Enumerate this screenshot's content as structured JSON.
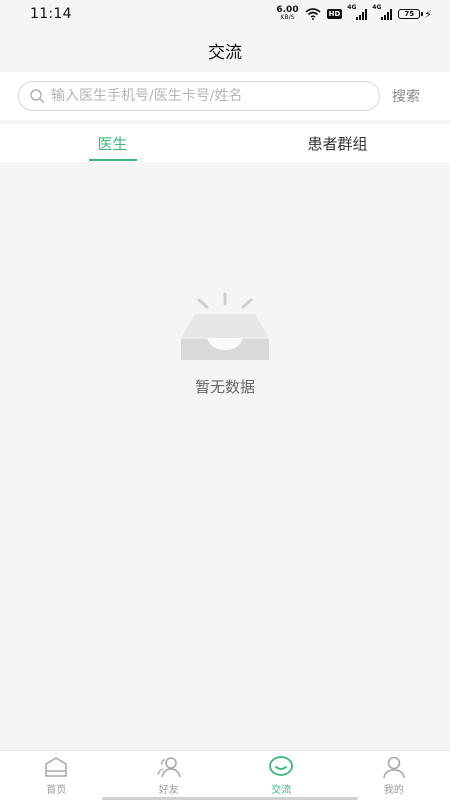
{
  "status_bar": {
    "time": "11:14",
    "net_speed": "6.00",
    "net_unit": "KB/S",
    "hd_badge": "HD",
    "signal_1": "4G",
    "signal_2": "4G",
    "battery": "75"
  },
  "header": {
    "title": "交流"
  },
  "search": {
    "placeholder": "输入医生手机号/医生卡号/姓名",
    "value": "",
    "button_label": "搜索"
  },
  "tabs": [
    {
      "label": "医生",
      "active": true
    },
    {
      "label": "患者群组",
      "active": false
    }
  ],
  "empty_state": {
    "message": "暂无数据"
  },
  "bottom_nav": {
    "items": [
      {
        "label": "首页",
        "icon": "home-icon",
        "active": false
      },
      {
        "label": "好友",
        "icon": "friends-icon",
        "active": false
      },
      {
        "label": "交流",
        "icon": "chat-icon",
        "active": true
      },
      {
        "label": "我的",
        "icon": "profile-icon",
        "active": false
      }
    ]
  },
  "colors": {
    "accent": "#3bb77e",
    "background": "#f5f5f5",
    "inactive_nav": "#9a9a9a"
  }
}
